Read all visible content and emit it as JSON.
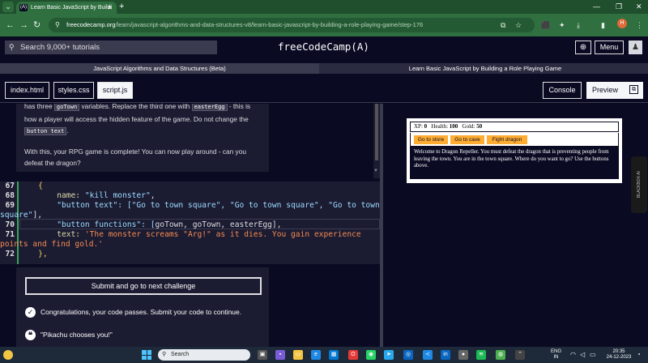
{
  "browser": {
    "tab_title": "Learn Basic JavaScript by Buildi",
    "tab_favicon": "(A)",
    "new_tab": "+",
    "url_host": "freecodecamp.org",
    "url_path": "/learn/javascript-algorithms-and-data-structures-v8/learn-basic-javascript-by-building-a-role-playing-game/step-176",
    "profile_initial": "H"
  },
  "nav": {
    "search_placeholder": "Search 9,000+ tutorials",
    "logo": "freeCodeCamp(🔥)",
    "logo_text": "freeCodeCamp(A)",
    "menu": "Menu"
  },
  "breadcrumb": {
    "superblock": "JavaScript Algorithms and Data Structures (Beta)",
    "block": "Learn Basic JavaScript by Building a Role Playing Game"
  },
  "file_tabs": [
    "index.html",
    "styles.css",
    "script.js"
  ],
  "console_label": "Console",
  "preview_label": "Preview",
  "instructions": {
    "p1_a": "has three ",
    "p1_code1": "goTown",
    "p1_b": " variables. Replace the third one with ",
    "p1_code2": "easterEgg",
    "p1_c": " - this is how a player will access the hidden feature of the game. Do not change the ",
    "p1_code3": "button text",
    "p1_d": ".",
    "p2": "With this, your RPG game is complete! You can now play around - can you defeat the dragon?"
  },
  "editor": {
    "line_numbers": [
      "67",
      "68",
      "69",
      "70",
      "71",
      "72"
    ],
    "l67": "    {",
    "l68_key": "        name: ",
    "l68_val": "\"kill monster\"",
    "l68_end": ",",
    "l69_key": "        \"button text\": [",
    "l69_val": "\"Go to town square\", \"Go to town square\", \"Go to town",
    "l69b_val": "square\"",
    "l69b_end": "],",
    "l70_key": "        \"button functions\": [",
    "l70_val": "goTown, goTown, easterEgg",
    "l70_end": "],",
    "l71_key": "        text: ",
    "l71_val": "'The monster screams \"Arg!\" as it dies. You gain experience",
    "l71b_val": "points and find gold.'",
    "l72": "    },"
  },
  "actions": {
    "submit": "Submit and go to next challenge",
    "pass_message": "Congratulations, your code passes. Submit your code to continue.",
    "quote": "\"Pikachu chooses you!\""
  },
  "game": {
    "xp_label": "XP:",
    "xp": "0",
    "health_label": "Health:",
    "health": "100",
    "gold_label": "Gold:",
    "gold": "50",
    "buttons": [
      "Go to store",
      "Go to cave",
      "Fight dragon"
    ],
    "text": "Welcome to Dragon Repeller. You must defeat the dragon that is preventing people from leaving the town. You are in the town square. Where do you want to go? Use the buttons above."
  },
  "blackbox": "BLACKBOX AI",
  "taskbar": {
    "search": "Search",
    "lang": "ENG",
    "region": "IN",
    "time": "20:35",
    "date": "24-12-2023"
  },
  "colors": {
    "browser_green": "#2f6f40",
    "fcc_dark": "#0a0a23",
    "panel": "#1b1b32",
    "game_button": "#feac32"
  }
}
